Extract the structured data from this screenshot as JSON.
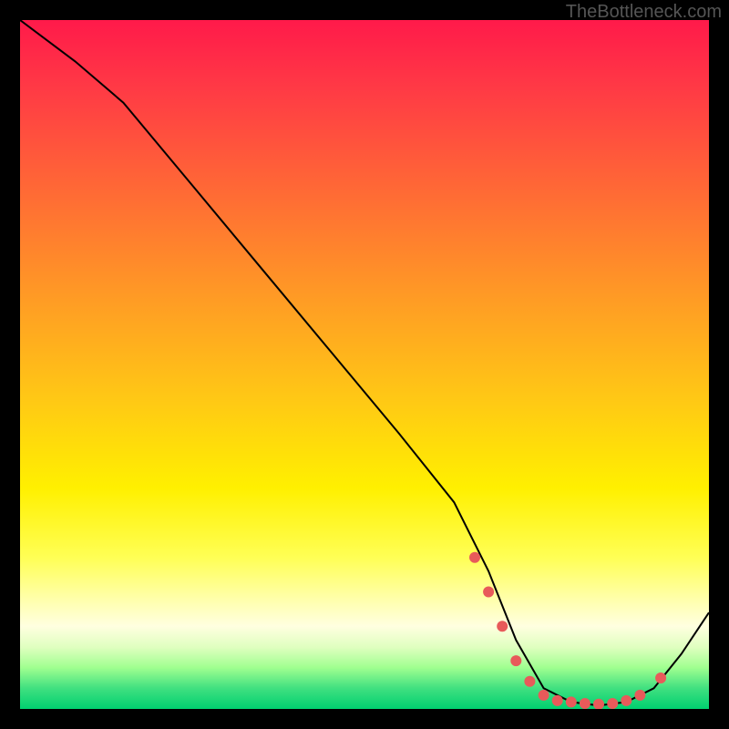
{
  "watermark": "TheBottleneck.com",
  "chart_data": {
    "type": "line",
    "title": "",
    "xlabel": "",
    "ylabel": "",
    "xlim": [
      0,
      100
    ],
    "ylim": [
      0,
      100
    ],
    "series": [
      {
        "name": "bottleneck-curve",
        "x": [
          0,
          4,
          8,
          15,
          25,
          35,
          45,
          55,
          63,
          68,
          72,
          76,
          80,
          84,
          88,
          92,
          96,
          100
        ],
        "y": [
          100,
          97,
          94,
          88,
          76,
          64,
          52,
          40,
          30,
          20,
          10,
          3,
          1,
          0.5,
          1,
          3,
          8,
          14
        ]
      }
    ],
    "markers": {
      "name": "highlight-points",
      "x": [
        66,
        68,
        70,
        72,
        74,
        76,
        78,
        80,
        82,
        84,
        86,
        88,
        90,
        93
      ],
      "y": [
        22,
        17,
        12,
        7,
        4,
        2,
        1.2,
        1,
        0.8,
        0.7,
        0.8,
        1.2,
        2,
        4.5
      ]
    },
    "colors": {
      "curve": "#000000",
      "marker": "#e85a5a"
    }
  }
}
